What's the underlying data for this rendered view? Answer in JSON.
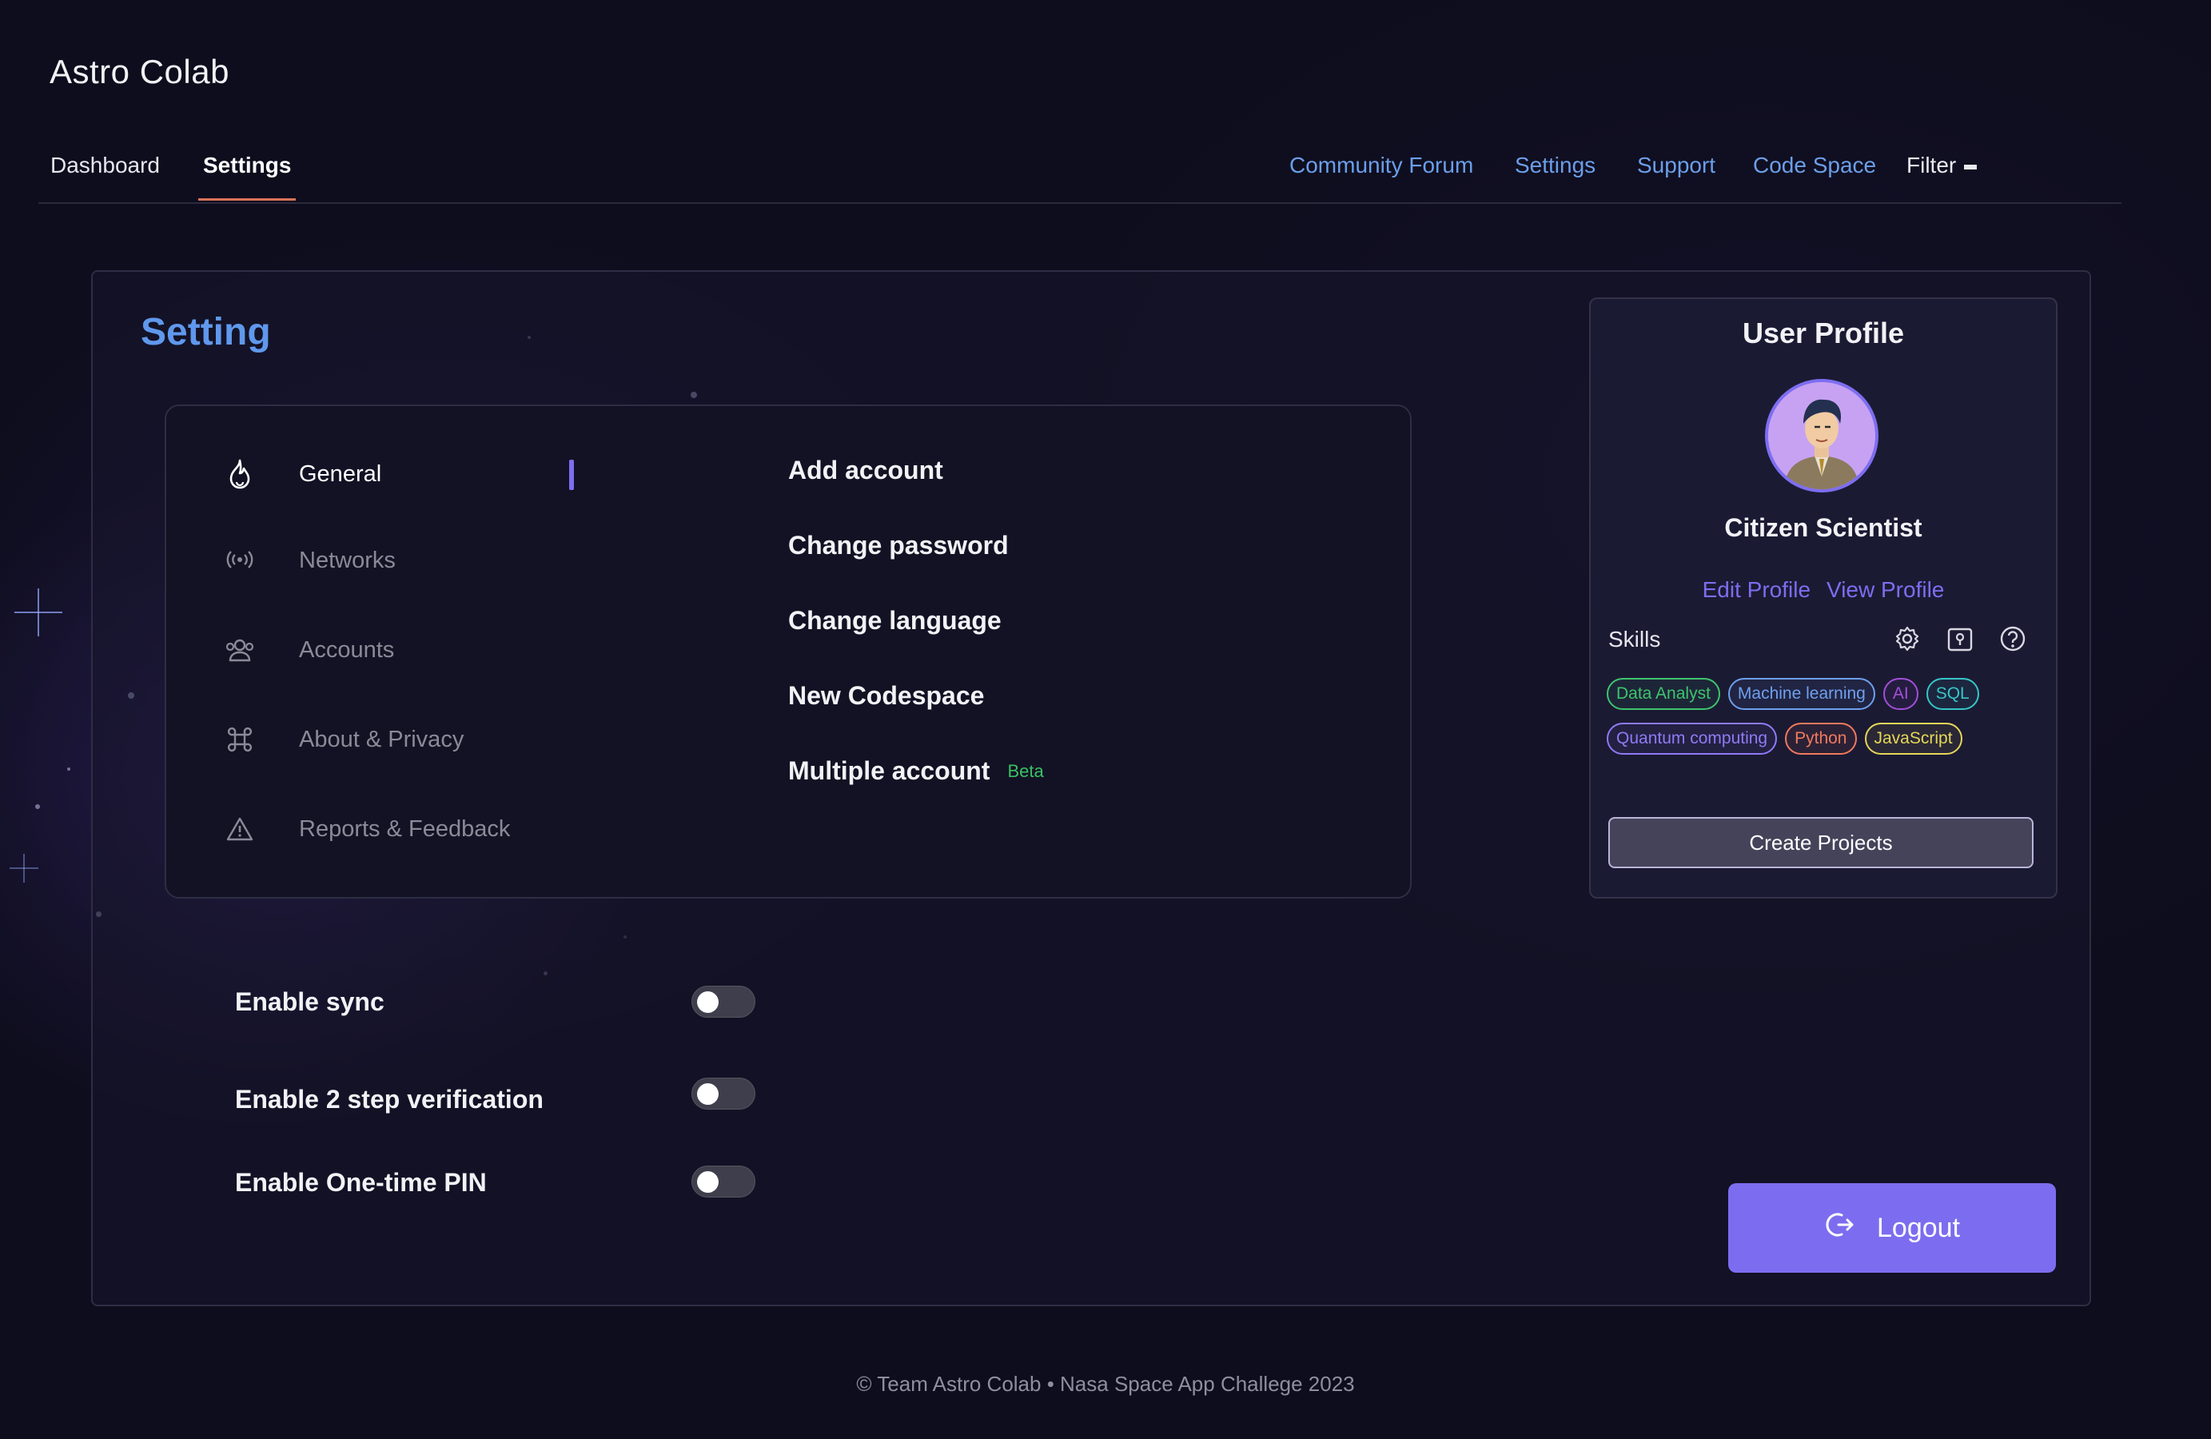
{
  "app": {
    "title": "Astro Colab"
  },
  "nav": {
    "tabs": [
      "Dashboard",
      "Settings"
    ],
    "active_tab": "Settings",
    "links": [
      "Community Forum",
      "Settings",
      "Support",
      "Code Space"
    ],
    "filter_label": "Filter"
  },
  "settings": {
    "title": "Setting",
    "menu": [
      {
        "label": "General",
        "icon": "flame-icon",
        "active": true
      },
      {
        "label": "Networks",
        "icon": "broadcast-icon",
        "active": false
      },
      {
        "label": "Accounts",
        "icon": "users-icon",
        "active": false
      },
      {
        "label": "About & Privacy",
        "icon": "command-icon",
        "active": false
      },
      {
        "label": "Reports & Feedback",
        "icon": "warning-icon",
        "active": false
      }
    ],
    "options": [
      {
        "label": "Add account"
      },
      {
        "label": "Change password"
      },
      {
        "label": "Change language"
      },
      {
        "label": "New Codespace"
      },
      {
        "label": "Multiple account",
        "badge": "Beta"
      }
    ],
    "toggles": [
      {
        "label": "Enable sync",
        "on": false
      },
      {
        "label": "Enable 2 step verification",
        "on": false
      },
      {
        "label": "Enable One-time PIN",
        "on": false
      }
    ]
  },
  "profile": {
    "title": "User Profile",
    "name": "Citizen Scientist",
    "edit_label": "Edit Profile",
    "view_label": "View Profile",
    "skills_label": "Skills",
    "icons": [
      "gear-icon",
      "user-badge-icon",
      "help-icon"
    ],
    "skills": [
      {
        "label": "Data Analyst",
        "color": "#3ec46d"
      },
      {
        "label": "Machine learning",
        "color": "#6ea0ee"
      },
      {
        "label": "AI",
        "color": "#a24fd6"
      },
      {
        "label": "SQL",
        "color": "#36c6c8"
      },
      {
        "label": "Quantum computing",
        "color": "#8d7bf5"
      },
      {
        "label": "Python",
        "color": "#f07a5e"
      },
      {
        "label": "JavaScript",
        "color": "#e6d75a"
      }
    ],
    "create_label": "Create Projects"
  },
  "logout_label": "Logout",
  "footer": "© Team Astro Colab • Nasa Space App Challege 2023",
  "colors": {
    "accent": "#7c6df0",
    "link": "#6b9fe8",
    "title": "#5f98ec",
    "tab_underline": "#d8735a"
  }
}
